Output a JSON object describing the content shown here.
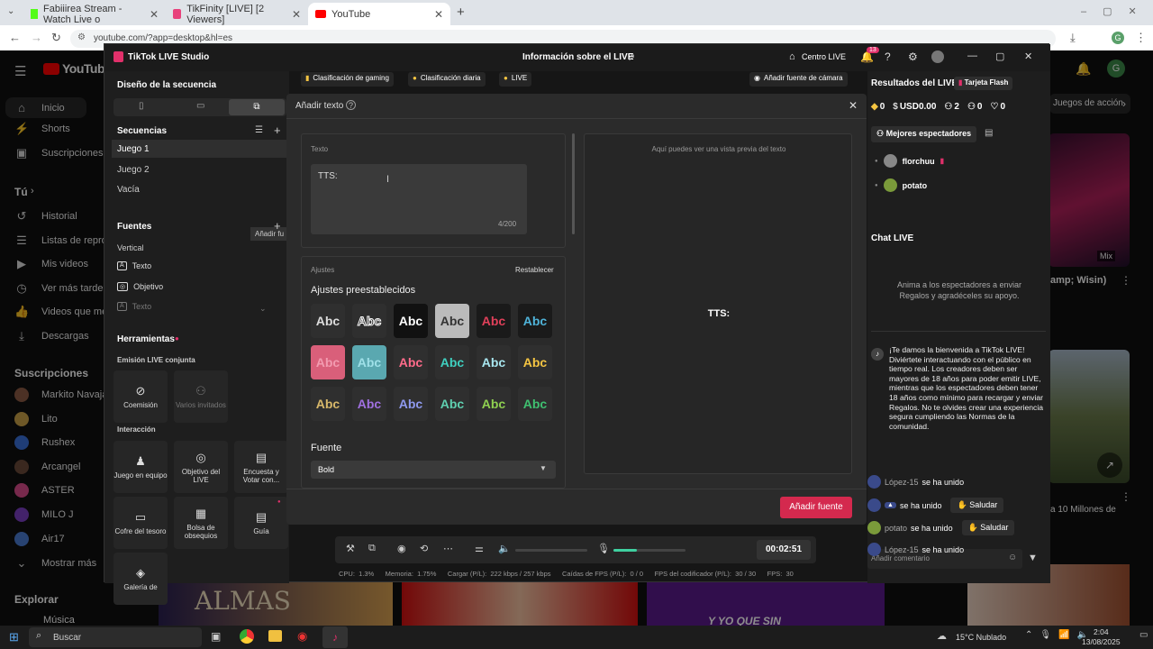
{
  "browser": {
    "tabs": [
      {
        "label": "Fabiiirea Stream - Watch Live o",
        "favicon_color": "#53fc18"
      },
      {
        "label": "TikFinity [LIVE] [2 Viewers]",
        "favicon_color": "#e8427c"
      },
      {
        "label": "YouTube",
        "favicon_color": "#ff0000"
      }
    ],
    "new_tab": "+",
    "url": "youtube.com/?app=desktop&hl=es"
  },
  "youtube": {
    "logo": "YouTube",
    "nav": [
      {
        "label": "Inicio",
        "icon": "home-icon",
        "glyph": "⌂"
      },
      {
        "label": "Shorts",
        "icon": "shorts-icon",
        "glyph": "⚡"
      },
      {
        "label": "Suscripciones",
        "icon": "subscriptions-icon",
        "glyph": "▣"
      }
    ],
    "you_header": "Tú",
    "you_items": [
      {
        "label": "Historial",
        "glyph": "↺"
      },
      {
        "label": "Listas de reprod",
        "glyph": "☰"
      },
      {
        "label": "Mis videos",
        "glyph": "▶"
      },
      {
        "label": "Ver más tarde",
        "glyph": "◷"
      },
      {
        "label": "Videos que me g",
        "glyph": "👍"
      },
      {
        "label": "Descargas",
        "glyph": "⤓"
      }
    ],
    "subs_header": "Suscripciones",
    "subs": [
      {
        "label": "Markito Navaja",
        "color": "#8a5a44"
      },
      {
        "label": "Lito",
        "color": "#c9a047"
      },
      {
        "label": "Rushex",
        "color": "#3a6fd8"
      },
      {
        "label": "Arcangel",
        "color": "#6b4a3a"
      },
      {
        "label": "ASTER",
        "color": "#d94c8a"
      },
      {
        "label": "MILO J",
        "color": "#7a3fc2"
      },
      {
        "label": "Air17",
        "color": "#4a7ad0"
      }
    ],
    "more": "Mostrar más",
    "explore": "Explorar",
    "music": "Música",
    "chip": "Juegos de acción",
    "side_video_title": "amp; Wisin)",
    "side_video2_title": "a 10 Millones de",
    "mix_label": "Mix",
    "thumb_texts": [
      "ALMAS",
      "Y YO QUE SIN QUERER"
    ],
    "avatar_letter": "G"
  },
  "studio": {
    "title": "TikTok LIVE Studio",
    "center_title": "Información sobre el LIVE",
    "centro_live": "Centro LIVE",
    "notif_count": "13",
    "top_chips": [
      "Clasificación de gaming",
      "Clasificación diaria",
      "LIVE"
    ],
    "camera_source": "Añadir fuente de cámara",
    "left": {
      "section_title": "Diseño de la secuencia",
      "sequences_title": "Secuencias",
      "sequences": [
        "Juego 1",
        "Juego 2",
        "Vacía"
      ],
      "sources_title": "Fuentes",
      "tooltip": "Añadir fu",
      "orientation": "Vertical",
      "sources": [
        {
          "label": "Texto",
          "glyph": "A"
        },
        {
          "label": "Objetivo",
          "glyph": "◎"
        },
        {
          "label": "Texto",
          "glyph": "A"
        }
      ],
      "tools_title": "Herramientas",
      "joint_title": "Emisión LIVE conjunta",
      "joint_tiles": [
        {
          "label": "Coemisión",
          "glyph": "⊘"
        },
        {
          "label": "Varios invitados",
          "glyph": "⚇"
        }
      ],
      "interaction_title": "Interacción",
      "interaction_tiles": [
        {
          "label": "Juego en equipo",
          "glyph": "♟"
        },
        {
          "label": "Objetivo del LIVE",
          "glyph": "◎"
        },
        {
          "label": "Encuesta y Votar con...",
          "glyph": "▤"
        },
        {
          "label": "Cofre del tesoro",
          "glyph": "▭"
        },
        {
          "label": "Bolsa de obsequios",
          "glyph": "▦"
        },
        {
          "label": "Guía",
          "glyph": "▤"
        },
        {
          "label": "Galería de",
          "glyph": "◈"
        }
      ]
    },
    "right": {
      "results_title": "Resultados del LIVE",
      "flash_card": "Tarjeta Flash",
      "stats": [
        {
          "icon": "coin-icon",
          "glyph": "◆",
          "value": "0"
        },
        {
          "icon": "money-icon",
          "glyph": "$",
          "value": "USD0.00"
        },
        {
          "icon": "viewers-icon",
          "glyph": "⚇",
          "value": "2"
        },
        {
          "icon": "followers-icon",
          "glyph": "⚇",
          "value": "0"
        },
        {
          "icon": "heart-icon",
          "glyph": "♡",
          "value": "0"
        }
      ],
      "top_viewers_btn": "Mejores espectadores",
      "top_viewers": [
        {
          "name": "florchuu",
          "color": "#888"
        },
        {
          "name": "potato",
          "color": "#7a9a3a"
        }
      ],
      "chat_title": "Chat LIVE",
      "chat_hint": "Anima a los espectadores a enviar Regalos y agradéceles su apoyo.",
      "welcome": "¡Te damos la bienvenida a TikTok LIVE! Diviértete interactuando con el público en tiempo real. Los creadores deben ser mayores de 18 años para poder emitir LIVE, mientras que los espectadores deben tener 18 años como mínimo para recargar y enviar Regalos. No te olvides crear una experiencia segura cumpliendo las Normas de la comunidad.",
      "joins": [
        {
          "name": "López-15",
          "text": "se ha unido",
          "button": ""
        },
        {
          "name": "",
          "text": "se ha unido",
          "button": "Saludar"
        },
        {
          "name": "potato",
          "text": "se ha unido",
          "button": "Saludar"
        },
        {
          "name": "López-15",
          "text": "se ha unido",
          "button": ""
        }
      ],
      "comment_placeholder": "Añadir comentario"
    },
    "bottom": {
      "timer": "00:02:51",
      "stats": "CPU:  1.3%      Memoria:  1.75%      Cargar (P/L):  222 kbps / 257 kbps      Caídas de FPS (P/L):  0 / 0      FPS del codificador (P/L):  30 / 30      FPS:  30",
      "volume_level": 0.0,
      "mic_level": 0.32
    }
  },
  "dialog": {
    "title": "Añadir texto",
    "text_label": "Texto",
    "text_value": "TTS:",
    "counter": "4/200",
    "preview_hint": "Aquí puedes ver una vista previa del texto",
    "preview_text": "TTS:",
    "settings_label": "Ajustes",
    "reset": "Restablecer",
    "presets_title": "Ajustes preestablecidos",
    "presets": [
      {
        "label": "Abc",
        "color": "#dddddd",
        "bg": "#2f2f2f"
      },
      {
        "label": "Abc",
        "color": "#222222",
        "bg": "#2f2f2f",
        "stroke": "#ffffff"
      },
      {
        "label": "Abc",
        "color": "#ffffff",
        "bg": "#111111"
      },
      {
        "label": "Abc",
        "color": "#333333",
        "bg": "#bbbbbb"
      },
      {
        "label": "Abc",
        "color": "#e0405a",
        "bg": "#1a1a1a"
      },
      {
        "label": "Abc",
        "color": "#4fb3d9",
        "bg": "#1a1a1a"
      },
      {
        "label": "Abc",
        "color": "#f29bb0",
        "bg": "#d95f7a"
      },
      {
        "label": "Abc",
        "color": "#9fe0e8",
        "bg": "#5aa8b0"
      },
      {
        "label": "Abc",
        "color": "#ff6b8a",
        "bg": "#2f2f2f"
      },
      {
        "label": "Abc",
        "color": "#3fd0c0",
        "bg": "#2f2f2f"
      },
      {
        "label": "Abc",
        "color": "#a8e6ef",
        "bg": "#2f2f2f"
      },
      {
        "label": "Abc",
        "color": "#f5c542",
        "bg": "#2f2f2f"
      },
      {
        "label": "Abc",
        "color": "#d8b86a",
        "bg": "#2f2f2f"
      },
      {
        "label": "Abc",
        "color": "#a070e0",
        "bg": "#2f2f2f"
      },
      {
        "label": "Abc",
        "color": "#8f9af0",
        "bg": "#2f2f2f"
      },
      {
        "label": "Abc",
        "color": "#5fd0b0",
        "bg": "#2f2f2f"
      },
      {
        "label": "Abc",
        "color": "#8fd050",
        "bg": "#2f2f2f"
      },
      {
        "label": "Abc",
        "color": "#3fc070",
        "bg": "#2f2f2f"
      }
    ],
    "font_title": "Fuente",
    "font_value": "Bold",
    "add_button": "Añadir fuente"
  },
  "taskbar": {
    "search": "Buscar",
    "weather": "15°C  Nublado",
    "time": "2:04",
    "date": "13/08/2025"
  },
  "colors": {
    "accent": "#d4294e",
    "yt_red": "#ff0000",
    "gold": "#f5c542"
  }
}
